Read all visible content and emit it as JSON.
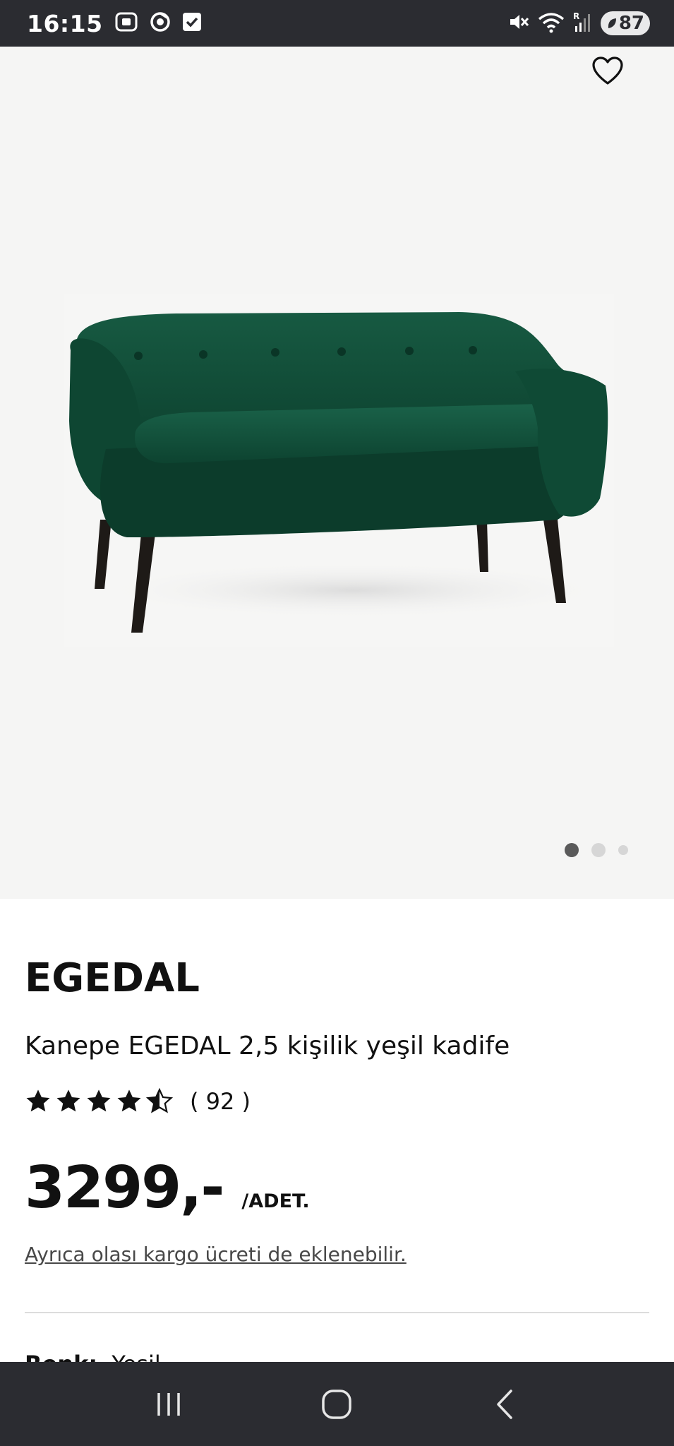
{
  "status_bar": {
    "time": "16:15",
    "battery": "87",
    "left_icons": [
      "screenshot-icon",
      "chrome-icon",
      "checkbox-icon"
    ],
    "right_icons": [
      "mute-icon",
      "wifi-icon",
      "signal-icon"
    ]
  },
  "gallery": {
    "image": "green-velvet-sofa",
    "dots_total": 3,
    "active_dot": 0
  },
  "product": {
    "brand": "EGEDAL",
    "description": "Kanepe EGEDAL 2,5 kişilik yeşil kadife",
    "rating": 4.5,
    "rating_count": "( 92 )",
    "price": "3299,-",
    "unit": "/ADET.",
    "shipping_note": "Ayrıca olası kargo ücreti de eklenebilir.",
    "color_label": "Renk:",
    "color_value": "Yeşil"
  },
  "colors": {
    "bars": "#2b2c31",
    "gallery_bg": "#f5f5f4",
    "sofa": "#0f4a35",
    "text": "#111111"
  },
  "nav_bar": {
    "buttons": [
      "recent-apps-icon",
      "home-icon",
      "back-icon"
    ]
  }
}
